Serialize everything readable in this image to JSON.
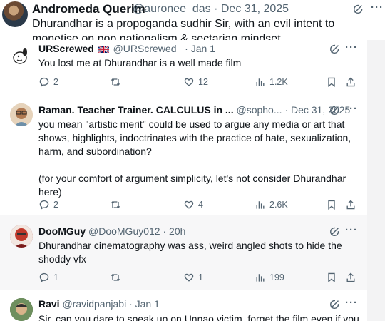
{
  "top_tweet": {
    "name": "Andromeda Querim",
    "handle": "@auronee_das",
    "date": "Dec 31, 2025",
    "text": "Dhurandhar is a propoganda sudhir Sir, with an evil intent to monetise on pop nationalism & sectarian mindset."
  },
  "replies": [
    {
      "name": "URScrewed",
      "handle": "@URScrewed_",
      "date": "Jan 1",
      "text": "You lost me at Dhurandhar is a well made film",
      "replies": "2",
      "retweets": "",
      "likes": "12",
      "views": "1.2K"
    },
    {
      "name": "Raman. Teacher Trainer. CALCULUS in ...",
      "handle": "@sopho...",
      "date": "Dec 31, 2025",
      "text": "you mean \"artistic merit\" could be used to argue any media or art that shows, highlights, indoctrinates with the practice of hate, sexualization, harm, and subordination?\n\n(for your comfort of argument simplicity, let's not consider Dhurandhar here)",
      "replies": "2",
      "retweets": "",
      "likes": "4",
      "views": "2.6K"
    },
    {
      "name": "DooMGuy",
      "handle": "@DooMGuy012",
      "date": "20h",
      "text": "Dhurandhar cinematography was ass, weird angled shots to hide the shoddy vfx",
      "replies": "1",
      "retweets": "",
      "likes": "1",
      "views": "199"
    },
    {
      "name": "Ravi",
      "handle": "@ravidpanjabi",
      "date": "Jan 1",
      "text": "Sir, can you dare to speak up on Unnao victim, forget the film even if you"
    }
  ],
  "icons": {
    "grok": "grok-icon",
    "more": "more-icon",
    "reply": "reply-icon",
    "retweet": "retweet-icon",
    "like": "like-icon",
    "views": "views-icon",
    "bookmark": "bookmark-icon",
    "share": "share-icon",
    "flag": "uk-flag-icon"
  },
  "colors": {
    "text": "#0f1419",
    "secondary": "#536471",
    "background": "#f3f3f4"
  }
}
